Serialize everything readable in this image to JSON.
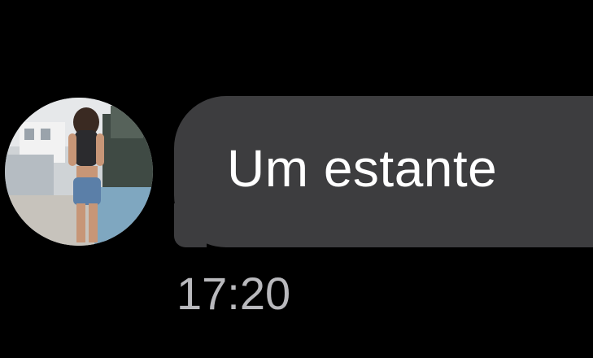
{
  "conversation": {
    "message": {
      "text": "Um estante",
      "timestamp": "17:20",
      "sender_avatar": "contact-avatar-photo"
    }
  },
  "colors": {
    "background": "#000000",
    "bubble": "#3d3d3f",
    "message_text": "#ffffff",
    "timestamp_text": "#b9b9bd"
  }
}
